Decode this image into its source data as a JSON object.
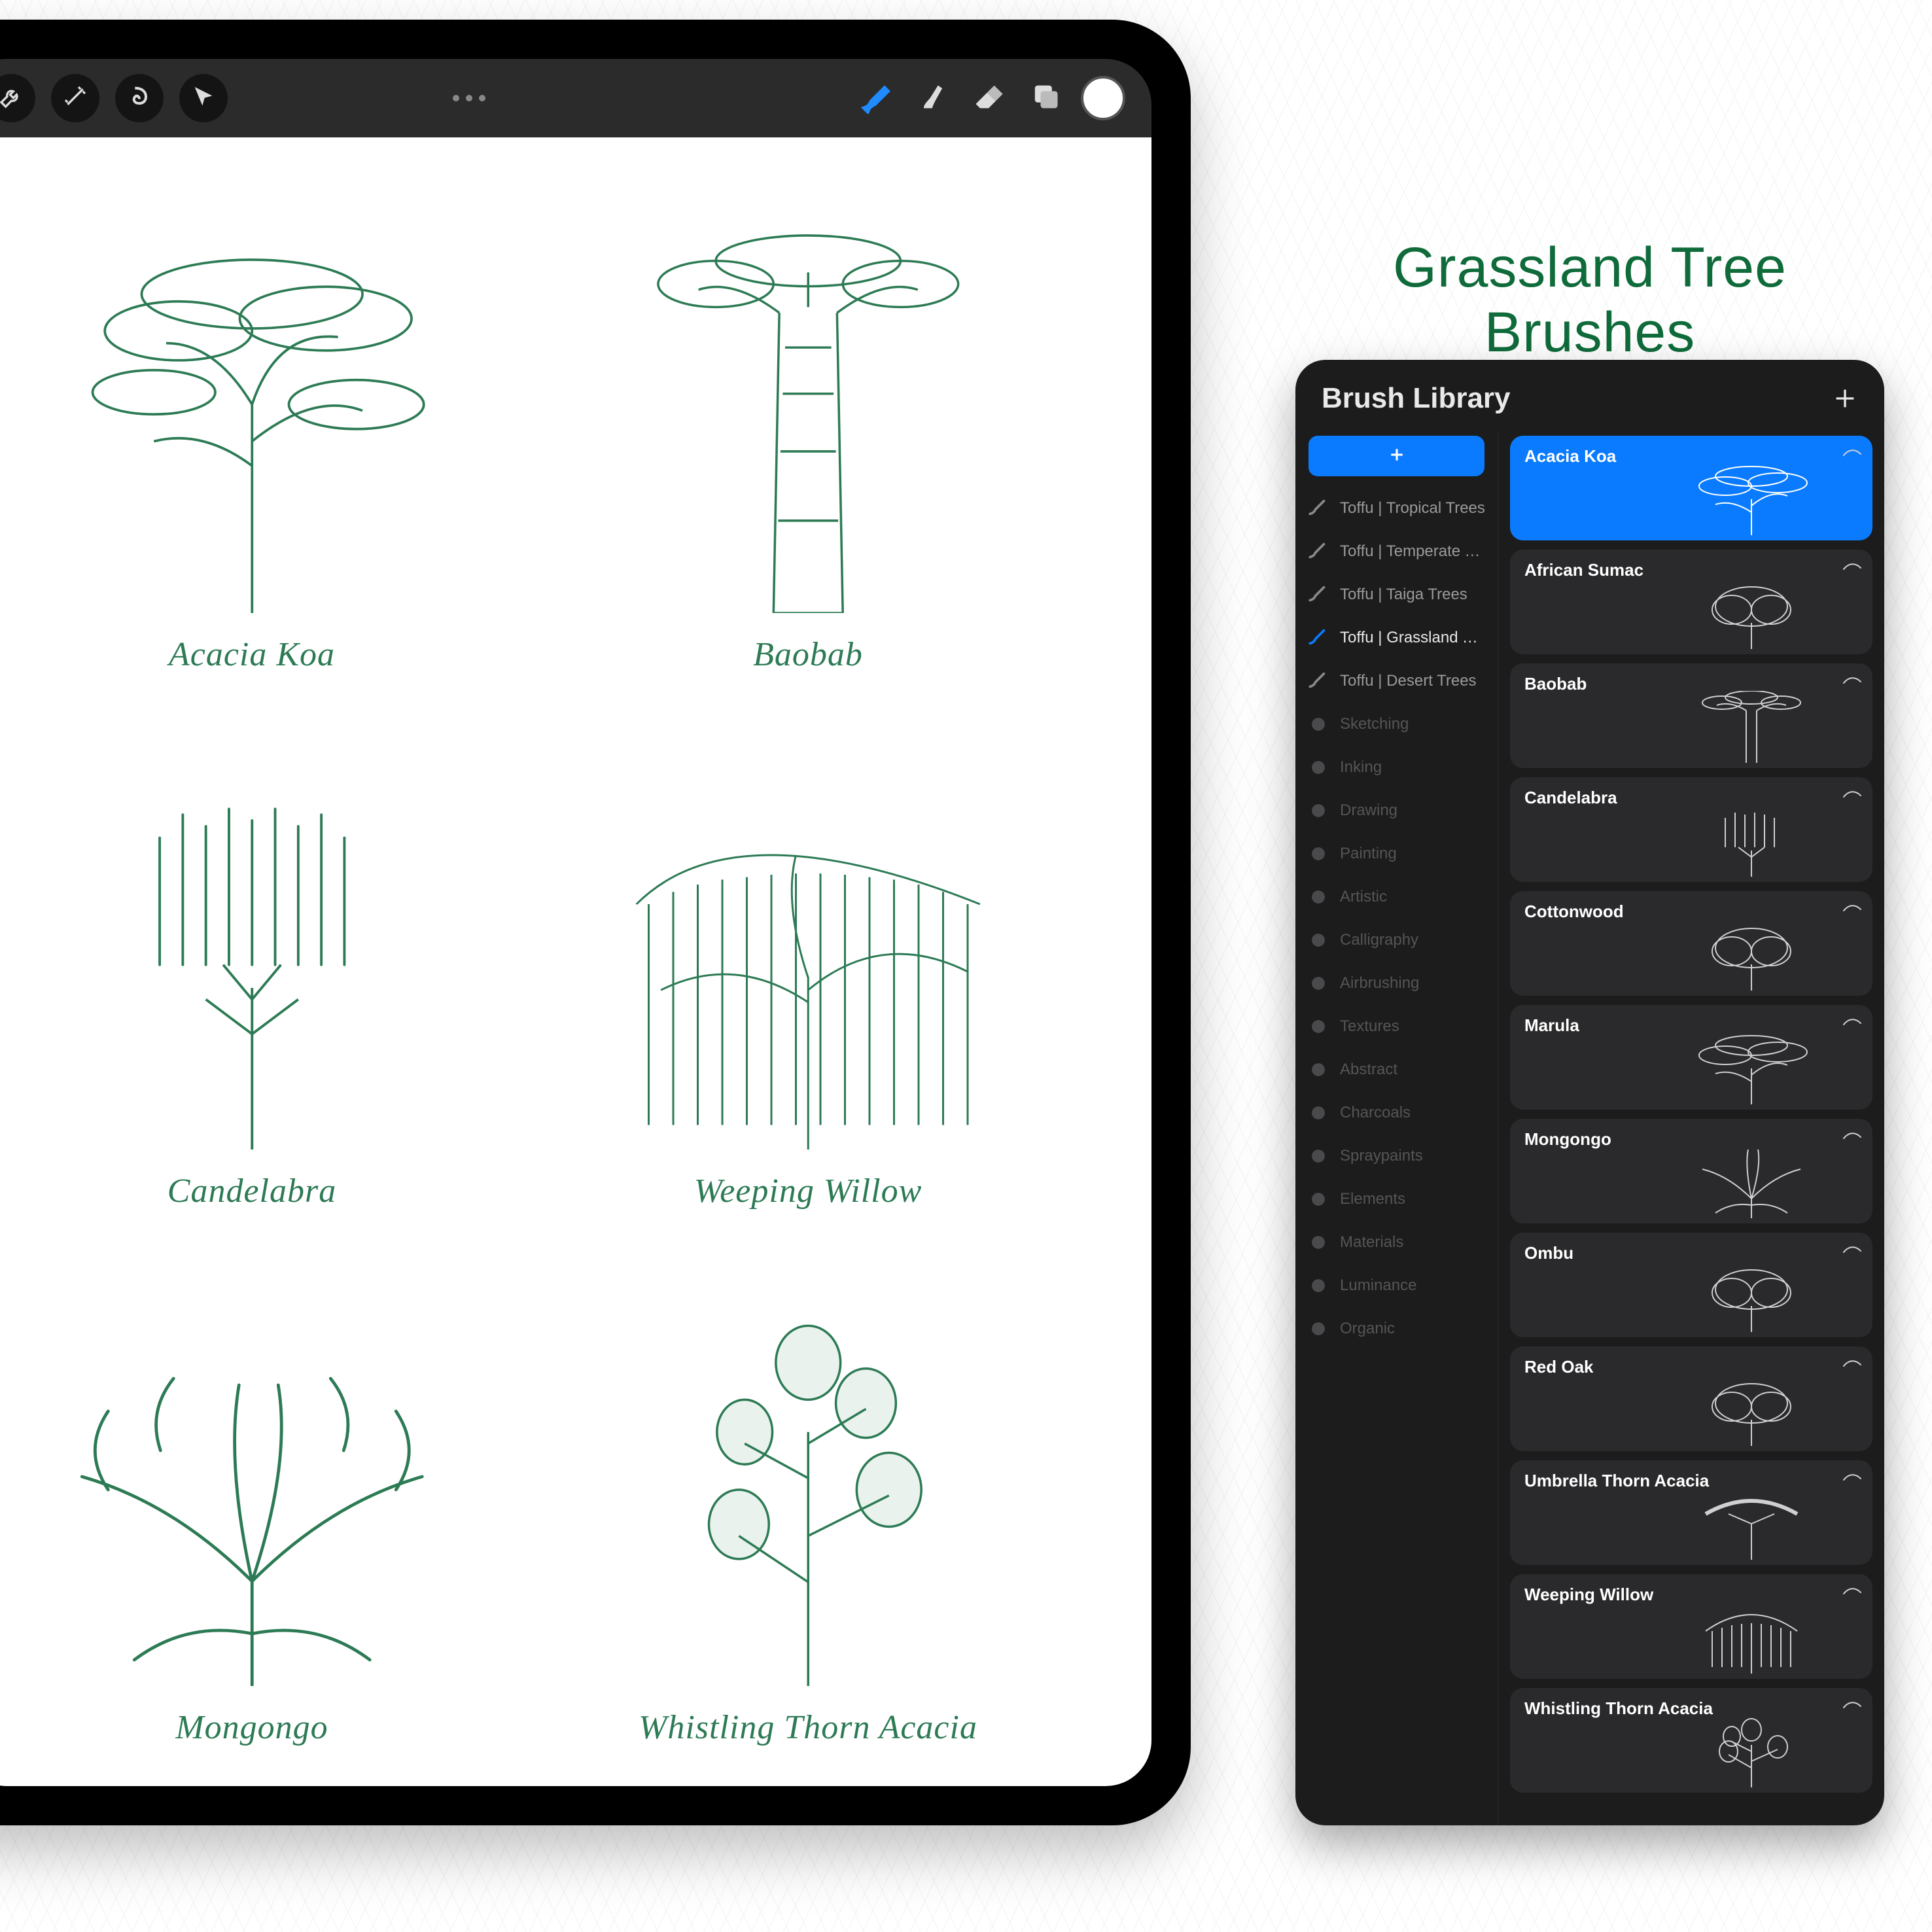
{
  "promo": {
    "title": "Grassland Tree Brushes"
  },
  "colors": {
    "accent": "#0a7bff",
    "brand": "#0f6b3a",
    "treeLine": "#2d7b55"
  },
  "toolbar": {
    "left_tools": [
      {
        "name": "wrench-icon"
      },
      {
        "name": "adjust-icon"
      },
      {
        "name": "selection-icon"
      },
      {
        "name": "move-icon"
      }
    ],
    "right_tools": [
      {
        "name": "brush-icon",
        "active": true
      },
      {
        "name": "smudge-icon",
        "active": false
      },
      {
        "name": "eraser-icon",
        "active": false
      },
      {
        "name": "layers-icon",
        "active": false
      }
    ],
    "swatch_color": "#ffffff"
  },
  "canvas": {
    "trees": [
      {
        "label": "Acacia Koa"
      },
      {
        "label": "Baobab"
      },
      {
        "label": "Candelabra"
      },
      {
        "label": "Weeping Willow"
      },
      {
        "label": "Mongongo"
      },
      {
        "label": "Whistling Thorn Acacia"
      }
    ]
  },
  "panel": {
    "title": "Brush Library",
    "sets": [
      {
        "label": "Toffu | Tropical Trees",
        "kind": "custom",
        "active": false
      },
      {
        "label": "Toffu | Temperate Tre…",
        "kind": "custom",
        "active": false
      },
      {
        "label": "Toffu | Taiga Trees",
        "kind": "custom",
        "active": false
      },
      {
        "label": "Toffu | Grassland Trees",
        "kind": "custom",
        "active": true
      },
      {
        "label": "Toffu | Desert Trees",
        "kind": "custom",
        "active": false
      },
      {
        "label": "Sketching",
        "kind": "builtin",
        "active": false
      },
      {
        "label": "Inking",
        "kind": "builtin",
        "active": false
      },
      {
        "label": "Drawing",
        "kind": "builtin",
        "active": false
      },
      {
        "label": "Painting",
        "kind": "builtin",
        "active": false
      },
      {
        "label": "Artistic",
        "kind": "builtin",
        "active": false
      },
      {
        "label": "Calligraphy",
        "kind": "builtin",
        "active": false
      },
      {
        "label": "Airbrushing",
        "kind": "builtin",
        "active": false
      },
      {
        "label": "Textures",
        "kind": "builtin",
        "active": false
      },
      {
        "label": "Abstract",
        "kind": "builtin",
        "active": false
      },
      {
        "label": "Charcoals",
        "kind": "builtin",
        "active": false
      },
      {
        "label": "Spraypaints",
        "kind": "builtin",
        "active": false
      },
      {
        "label": "Elements",
        "kind": "builtin",
        "active": false
      },
      {
        "label": "Materials",
        "kind": "builtin",
        "active": false
      },
      {
        "label": "Luminance",
        "kind": "builtin",
        "active": false
      },
      {
        "label": "Organic",
        "kind": "builtin",
        "active": false
      }
    ],
    "brushes": [
      {
        "name": "Acacia Koa",
        "shape": "acacia",
        "selected": true
      },
      {
        "name": "African Sumac",
        "shape": "bush",
        "selected": false
      },
      {
        "name": "Baobab",
        "shape": "baobab",
        "selected": false
      },
      {
        "name": "Candelabra",
        "shape": "candelabra",
        "selected": false
      },
      {
        "name": "Cottonwood",
        "shape": "bush",
        "selected": false
      },
      {
        "name": "Marula",
        "shape": "acacia",
        "selected": false
      },
      {
        "name": "Mongongo",
        "shape": "mongongo",
        "selected": false
      },
      {
        "name": "Ombu",
        "shape": "bush",
        "selected": false
      },
      {
        "name": "Red Oak",
        "shape": "bush",
        "selected": false
      },
      {
        "name": "Umbrella Thorn Acacia",
        "shape": "umbrella",
        "selected": false
      },
      {
        "name": "Weeping Willow",
        "shape": "willow",
        "selected": false
      },
      {
        "name": "Whistling Thorn Acacia",
        "shape": "thorn",
        "selected": false
      }
    ]
  }
}
